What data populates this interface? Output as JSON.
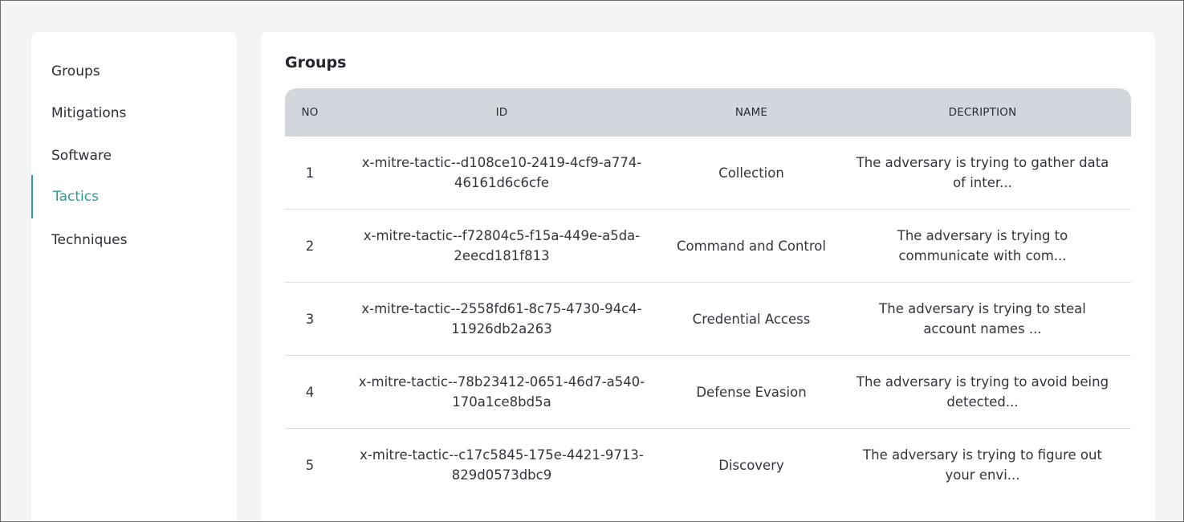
{
  "sidebar": {
    "items": [
      {
        "label": "Groups"
      },
      {
        "label": "Mitigations"
      },
      {
        "label": "Software"
      },
      {
        "label": "Tactics"
      },
      {
        "label": "Techniques"
      }
    ]
  },
  "main": {
    "title": "Groups",
    "table": {
      "headers": {
        "no": "NO",
        "id": "ID",
        "name": "NAME",
        "description": "DECRIPTION"
      },
      "rows": [
        {
          "no": "1",
          "id": "x-mitre-tactic--d108ce10-2419-4cf9-a774-46161d6c6cfe",
          "name": "Collection",
          "description": "The adversary is trying to gather data of inter..."
        },
        {
          "no": "2",
          "id": "x-mitre-tactic--f72804c5-f15a-449e-a5da-2eecd181f813",
          "name": "Command and Control",
          "description": "The adversary is trying to communicate with com..."
        },
        {
          "no": "3",
          "id": "x-mitre-tactic--2558fd61-8c75-4730-94c4-11926db2a263",
          "name": "Credential Access",
          "description": "The adversary is trying to steal account names ..."
        },
        {
          "no": "4",
          "id": "x-mitre-tactic--78b23412-0651-46d7-a540-170a1ce8bd5a",
          "name": "Defense Evasion",
          "description": "The adversary is trying to avoid being detected..."
        },
        {
          "no": "5",
          "id": "x-mitre-tactic--c17c5845-175e-4421-9713-829d0573dbc9",
          "name": "Discovery",
          "description": "The adversary is trying to figure out your envi..."
        }
      ]
    }
  },
  "colors": {
    "accent": "#2e9d97",
    "page_background": "#f3f4f6",
    "table_header": "#d3d6dd"
  }
}
